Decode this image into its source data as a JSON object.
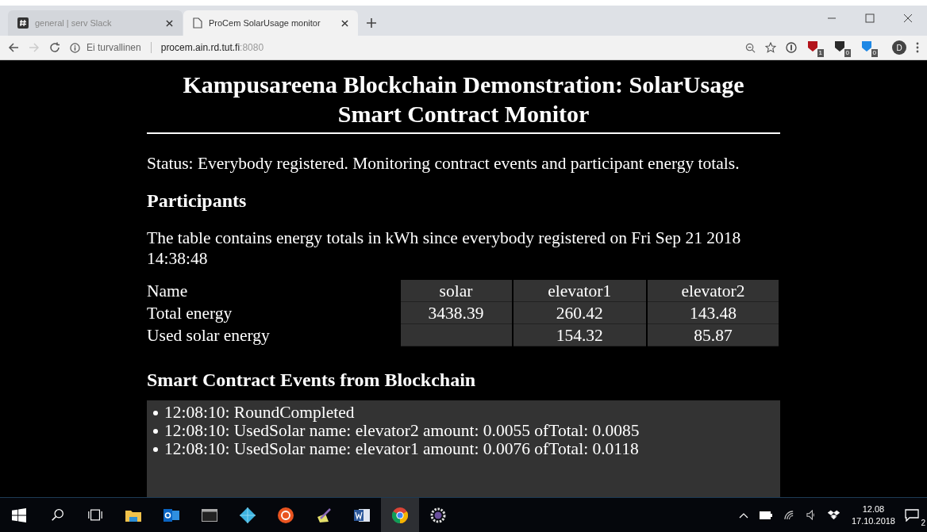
{
  "browser": {
    "tabs": [
      {
        "kind": "slack",
        "title": "general | serv Slack",
        "selected": false
      },
      {
        "kind": "page",
        "title": "ProCem SolarUsage monitor",
        "selected": true
      }
    ],
    "address": {
      "security": "Ei turvallinen",
      "host": "procem.ain.rd.tut.fi",
      "port": ":8080"
    },
    "profile": "D",
    "extension_badges": [
      "1",
      "0",
      "0"
    ]
  },
  "page": {
    "title": "Kampusareena Blockchain Demonstration: SolarUsage Smart Contract Monitor",
    "status": "Status: Everybody registered. Monitoring contract events and participant energy totals.",
    "participants": {
      "heading": "Participants",
      "description": "The table contains energy totals in kWh since everybody registered on Fri Sep 21 2018 14:38:48",
      "columns": [
        "Name",
        "solar",
        "elevator1",
        "elevator2"
      ],
      "rows": [
        [
          "Total energy",
          "3438.39",
          "260.42",
          "143.48"
        ],
        [
          "Used solar energy",
          "",
          "154.32",
          "85.87"
        ]
      ]
    },
    "events": {
      "heading": "Smart Contract Events from Blockchain",
      "items": [
        "12:08:10: RoundCompleted",
        "12:08:10: UsedSolar name: elevator2 amount: 0.0055 ofTotal: 0.0085",
        "12:08:10: UsedSolar name: elevator1 amount: 0.0076 ofTotal: 0.0118"
      ]
    }
  },
  "taskbar": {
    "apps": [
      {
        "kind": "start",
        "selected": false
      },
      {
        "kind": "search",
        "selected": false
      },
      {
        "kind": "taskview",
        "selected": false
      },
      {
        "kind": "folder",
        "selected": false
      },
      {
        "kind": "mail",
        "selected": false
      },
      {
        "kind": "terminal",
        "selected": false
      },
      {
        "kind": "diamond",
        "selected": false
      },
      {
        "kind": "ubuntu",
        "selected": false
      },
      {
        "kind": "pen",
        "selected": false
      },
      {
        "kind": "word",
        "selected": false
      },
      {
        "kind": "chrome",
        "selected": true
      },
      {
        "kind": "gear",
        "selected": false
      }
    ],
    "time": "12.08",
    "date": "17.10.2018",
    "notifications": "2"
  }
}
